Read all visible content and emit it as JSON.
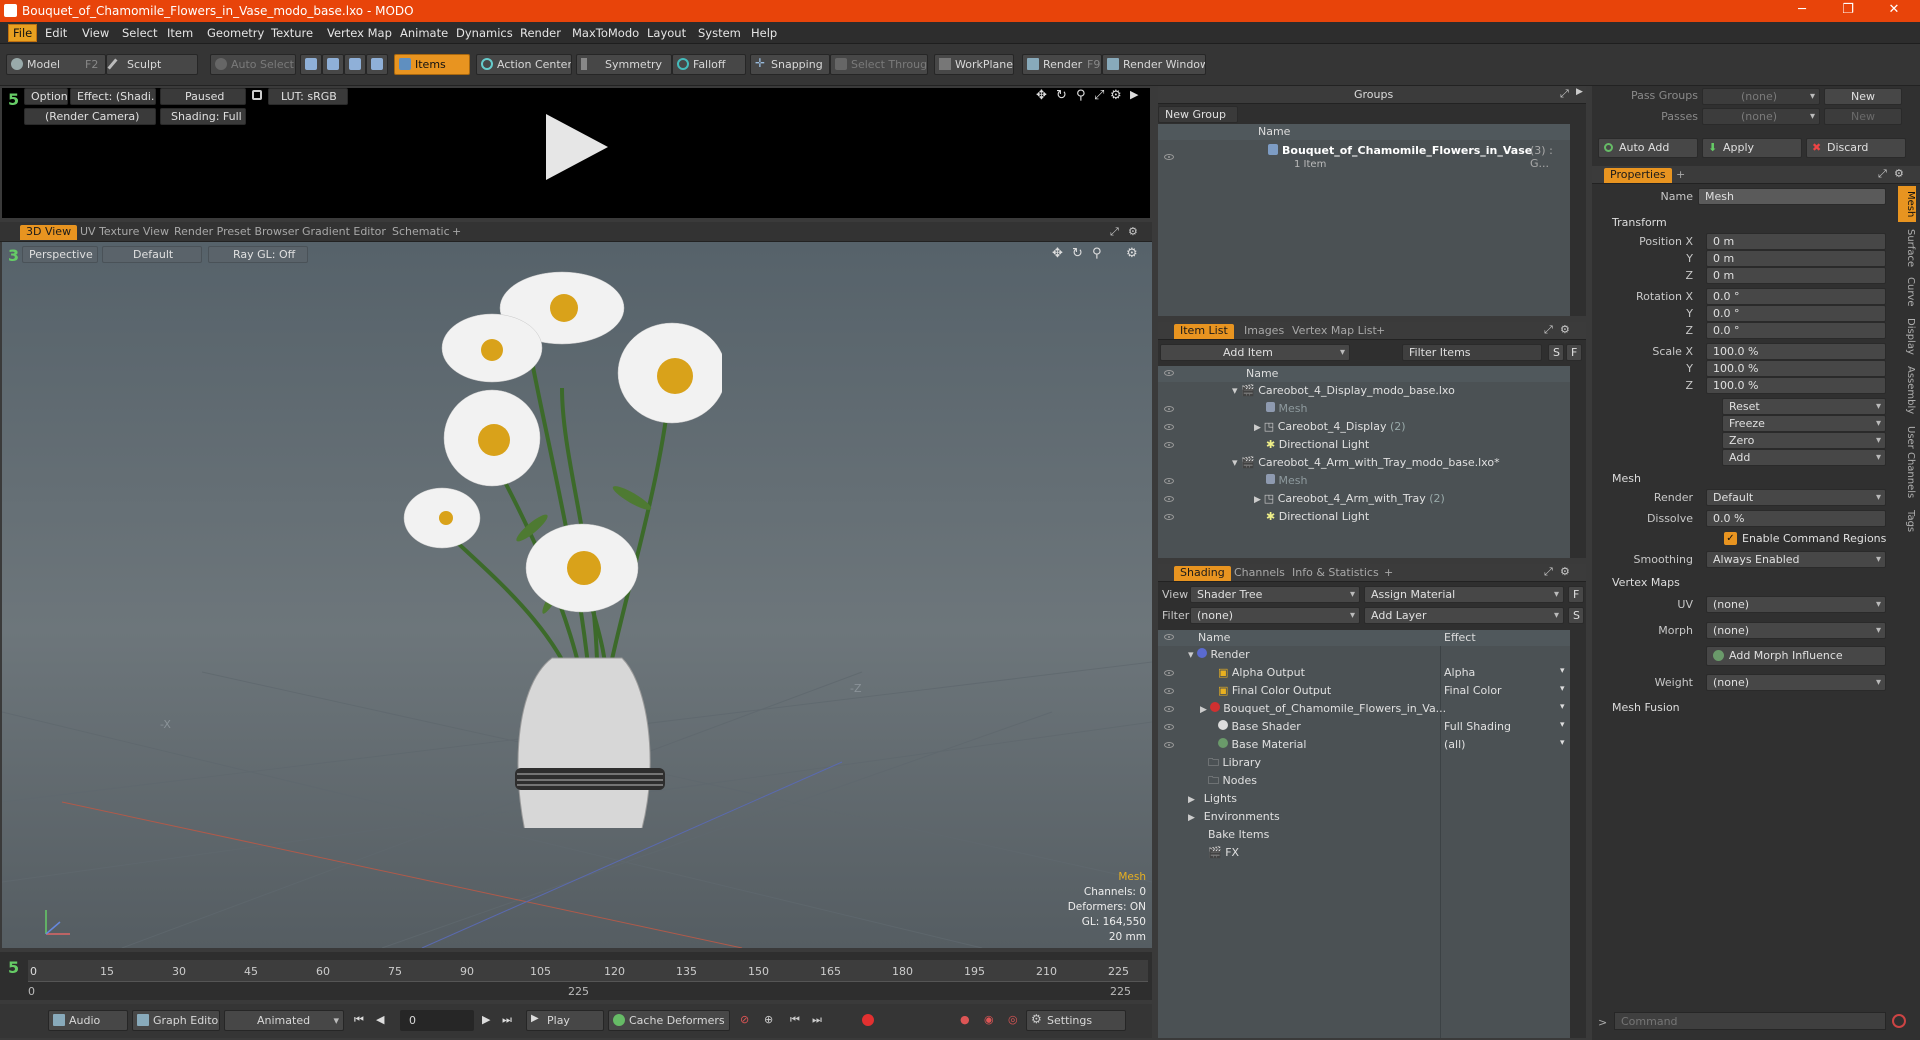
{
  "window": {
    "title": "Bouquet_of_Chamomile_Flowers_in_Vase_modo_base.lxo - MODO"
  },
  "menu": [
    "File",
    "Edit",
    "View",
    "Select",
    "Item",
    "Geometry",
    "Texture",
    "Vertex Map",
    "Animate",
    "Dynamics",
    "Render",
    "MaxToModo",
    "Layout",
    "System",
    "Help"
  ],
  "toolbar": {
    "model": "Model",
    "model_key": "F2",
    "sculpt": "Sculpt",
    "auto_select": "Auto Select",
    "items": "Items",
    "action_center": "Action Center",
    "symmetry": "Symmetry",
    "falloff": "Falloff",
    "snapping": "Snapping",
    "select_through": "Select Through",
    "workplane": "WorkPlane",
    "render": "Render",
    "render_key": "F9",
    "render_window": "Render Window"
  },
  "preview": {
    "options": "Options",
    "effect": "Effect: (Shadi...",
    "paused": "Paused",
    "lut": "LUT: sRGB",
    "camera": "(Render Camera)",
    "shading": "Shading: Full"
  },
  "viewport_tabs": [
    "3D View",
    "UV Texture View",
    "Render Preset Browser",
    "Gradient Editor",
    "Schematic",
    "+"
  ],
  "viewport": {
    "perspective": "Perspective",
    "default": "Default",
    "raygl": "Ray GL: Off",
    "axis_x": "-X",
    "axis_z": "-Z",
    "info": {
      "mesh": "Mesh",
      "channels": "Channels: 0",
      "deformers": "Deformers: ON",
      "gl": "GL: 164,550",
      "size": "20 mm"
    }
  },
  "timeline": {
    "ticks": [
      "0",
      "15",
      "30",
      "45",
      "60",
      "75",
      "90",
      "105",
      "120",
      "135",
      "150",
      "165",
      "180",
      "195",
      "210",
      "225"
    ],
    "range_start": "0",
    "range_mid": "225",
    "range_end": "225"
  },
  "bottombar": {
    "audio": "Audio",
    "graph_editor": "Graph Editor",
    "animated": "Animated",
    "frame": "0",
    "play": "Play",
    "cache": "Cache Deformers",
    "settings": "Settings"
  },
  "groups": {
    "title": "Groups",
    "new_group": "New Group",
    "col_name": "Name",
    "item_name": "Bouquet_of_Chamomile_Flowers_in_Vase",
    "item_count": "(3) : G...",
    "item_sub": "1 Item"
  },
  "itemlist": {
    "tabs": [
      "Item List",
      "Images",
      "Vertex Map List",
      "+"
    ],
    "add_item": "Add Item",
    "filter": "Filter Items",
    "btn_s": "S",
    "btn_f": "F",
    "col_name": "Name",
    "rows": [
      {
        "label": "Careobot_4_Display_modo_base.lxo",
        "suffix": ""
      },
      {
        "label": "Mesh",
        "suffix": ""
      },
      {
        "label": "Careobot_4_Display",
        "suffix": "(2)"
      },
      {
        "label": "Directional Light",
        "suffix": ""
      },
      {
        "label": "Careobot_4_Arm_with_Tray_modo_base.lxo*",
        "suffix": ""
      },
      {
        "label": "Mesh",
        "suffix": ""
      },
      {
        "label": "Careobot_4_Arm_with_Tray",
        "suffix": "(2)"
      },
      {
        "label": "Directional Light",
        "suffix": ""
      }
    ]
  },
  "shading": {
    "tabs": [
      "Shading",
      "Channels",
      "Info & Statistics",
      "+"
    ],
    "view_label": "View",
    "view_value": "Shader Tree",
    "assign": "Assign Material",
    "btn_f": "F",
    "filter_label": "Filter",
    "filter_value": "(none)",
    "add_layer": "Add Layer",
    "btn_s": "S",
    "col_name": "Name",
    "col_effect": "Effect",
    "rows": [
      {
        "name": "Render",
        "effect": ""
      },
      {
        "name": "Alpha Output",
        "effect": "Alpha"
      },
      {
        "name": "Final Color Output",
        "effect": "Final Color"
      },
      {
        "name": "Bouquet_of_Chamomile_Flowers_in_Va...",
        "effect": ""
      },
      {
        "name": "Base Shader",
        "effect": "Full Shading"
      },
      {
        "name": "Base Material",
        "effect": "(all)"
      },
      {
        "name": "Library",
        "effect": ""
      },
      {
        "name": "Nodes",
        "effect": ""
      },
      {
        "name": "Lights",
        "effect": ""
      },
      {
        "name": "Environments",
        "effect": ""
      },
      {
        "name": "Bake Items",
        "effect": ""
      },
      {
        "name": "FX",
        "effect": ""
      }
    ]
  },
  "passes": {
    "pass_groups": "Pass Groups",
    "passes": "Passes",
    "none": "(none)",
    "new": "New",
    "auto_add": "Auto Add",
    "apply": "Apply",
    "discard": "Discard"
  },
  "properties": {
    "tab": "Properties",
    "name_label": "Name",
    "name_value": "Mesh",
    "transform": "Transform",
    "position_label": "Position X",
    "rotation_label": "Rotation X",
    "scale_label": "Scale X",
    "y": "Y",
    "z": "Z",
    "position": [
      "0 m",
      "0 m",
      "0 m"
    ],
    "rotation": [
      "0.0 °",
      "0.0 °",
      "0.0 °"
    ],
    "scale": [
      "100.0 %",
      "100.0 %",
      "100.0 %"
    ],
    "actions": [
      "Reset",
      "Freeze",
      "Zero",
      "Add"
    ],
    "mesh": "Mesh",
    "render_label": "Render",
    "render_value": "Default",
    "dissolve_label": "Dissolve",
    "dissolve_value": "0.0 %",
    "cmd_regions": "Enable Command Regions",
    "smoothing_label": "Smoothing",
    "smoothing_value": "Always Enabled",
    "vertex_maps": "Vertex Maps",
    "uv_label": "UV",
    "uv_value": "(none)",
    "morph_label": "Morph",
    "morph_value": "(none)",
    "add_morph": "Add Morph Influence",
    "weight_label": "Weight",
    "weight_value": "(none)",
    "mesh_fusion": "Mesh Fusion",
    "side_tabs": [
      "Mesh",
      "Surface",
      "Curve",
      "Display",
      "Assembly",
      "User Channels",
      "Tags"
    ]
  },
  "command": {
    "placeholder": "Command"
  }
}
